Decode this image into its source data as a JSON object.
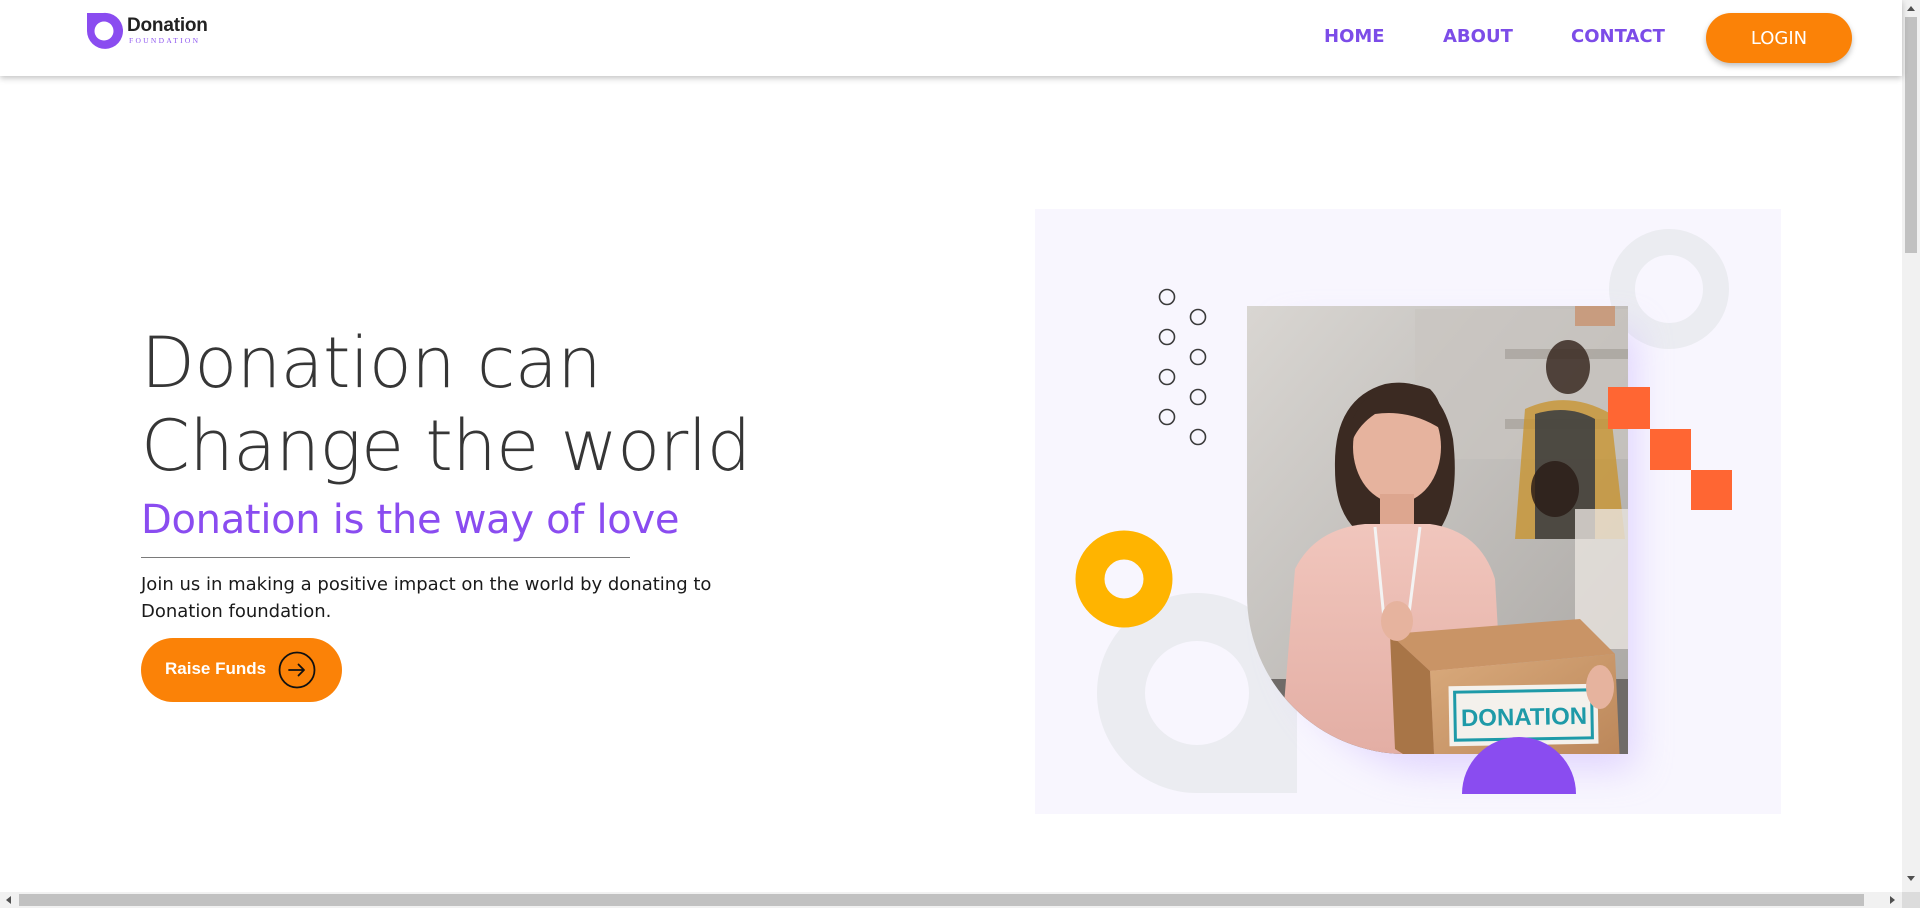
{
  "brand": {
    "name": "Donation",
    "tagline": "FOUNDATION",
    "logo_icon": "ring-logo-icon",
    "color": "#8a4cf0"
  },
  "nav": {
    "items": [
      {
        "label": "HOME"
      },
      {
        "label": "ABOUT"
      },
      {
        "label": "CONTACT"
      }
    ],
    "login_label": "LOGIN"
  },
  "hero": {
    "title_line1": "Donation can",
    "title_line2": "Change the world",
    "subtitle": "Donation is the way of love",
    "description": "Join us in making a positive impact on the world by donating to Donation foundation.",
    "cta_label": "Raise Funds",
    "cta_icon": "arrow-right-circle-icon"
  },
  "illustration": {
    "box_label": "DONATION",
    "photo_subject": "woman-holding-donation-box"
  },
  "colors": {
    "accent_orange": "#fb8207",
    "accent_purple": "#8a4cf0",
    "nav_purple": "#7c4ce8",
    "square_orange": "#ff6633",
    "donut_yellow": "#ffb400",
    "panel_bg": "#f8f6fe",
    "shape_gray": "#ebecf1"
  }
}
